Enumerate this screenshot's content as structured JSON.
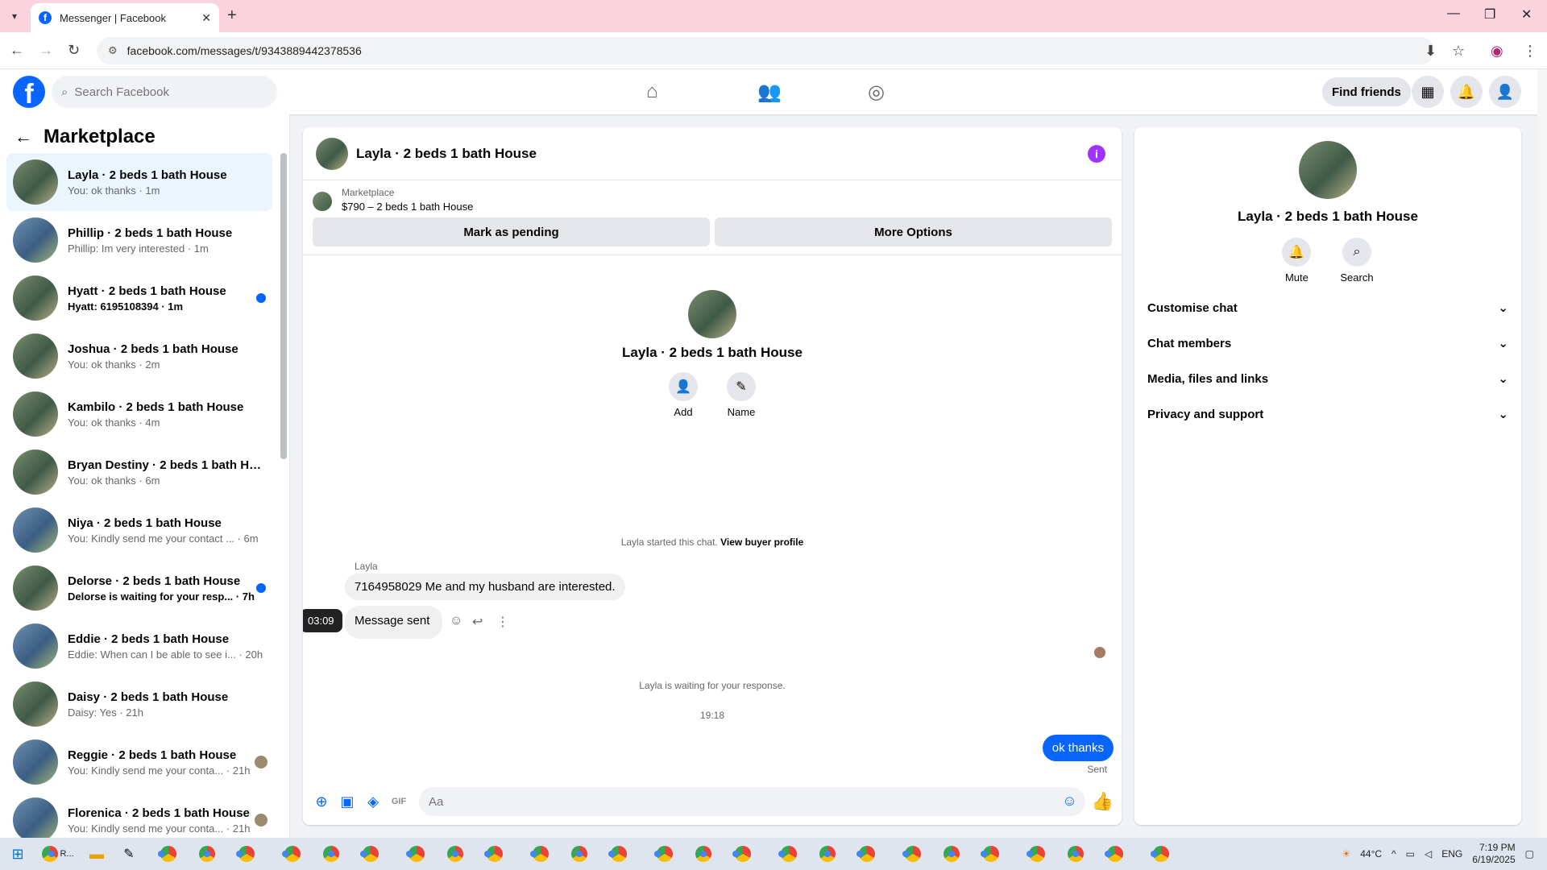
{
  "browser": {
    "tab_title": "Messenger | Facebook",
    "url": "facebook.com/messages/t/9343889442378536"
  },
  "header": {
    "search_placeholder": "Search Facebook",
    "find_friends": "Find friends"
  },
  "sidebar": {
    "title": "Marketplace",
    "conversations": [
      {
        "name": "Layla · 2 beds 1 bath House",
        "preview": "You: ok thanks · 1m",
        "active": true,
        "unread": false,
        "badge": ""
      },
      {
        "name": "Phillip · 2 beds 1 bath House",
        "preview": "Phillip: Im very interested · 1m",
        "active": false,
        "unread": false,
        "badge": ""
      },
      {
        "name": "Hyatt · 2 beds 1 bath House",
        "preview": "Hyatt: 6195108394 · 1m",
        "active": false,
        "unread": true,
        "badge": "dot"
      },
      {
        "name": "Joshua · 2 beds 1 bath House",
        "preview": "You: ok thanks · 2m",
        "active": false,
        "unread": false,
        "badge": ""
      },
      {
        "name": "Kambilo · 2 beds 1 bath House",
        "preview": "You: ok thanks · 4m",
        "active": false,
        "unread": false,
        "badge": ""
      },
      {
        "name": "Bryan Destiny · 2 beds 1 bath Ho...",
        "preview": "You: ok thanks · 6m",
        "active": false,
        "unread": false,
        "badge": ""
      },
      {
        "name": "Niya · 2 beds 1 bath House",
        "preview": "You: Kindly send me your contact ... · 6m",
        "active": false,
        "unread": false,
        "badge": ""
      },
      {
        "name": "Delorse · 2 beds 1 bath House",
        "preview": "Delorse is waiting for your resp... · 7h",
        "active": false,
        "unread": true,
        "badge": "dot"
      },
      {
        "name": "Eddie · 2 beds 1 bath House",
        "preview": "Eddie: When can I be able to see i... · 20h",
        "active": false,
        "unread": false,
        "badge": ""
      },
      {
        "name": "Daisy · 2 beds 1 bath House",
        "preview": "Daisy: Yes · 21h",
        "active": false,
        "unread": false,
        "badge": ""
      },
      {
        "name": "Reggie · 2 beds 1 bath House",
        "preview": "You: Kindly send me your conta... · 21h",
        "active": false,
        "unread": false,
        "badge": "avatar"
      },
      {
        "name": "Florenica · 2 beds 1 bath House",
        "preview": "You: Kindly send me your conta... · 21h",
        "active": false,
        "unread": false,
        "badge": "avatar"
      }
    ]
  },
  "chat": {
    "title": "Layla · 2 beds 1 bath House",
    "marketplace_label": "Marketplace",
    "listing": "$790 – 2 beds 1 bath House",
    "mark_pending": "Mark as pending",
    "more_options": "More Options",
    "intro_name": "Layla · 2 beds 1 bath House",
    "add_label": "Add",
    "name_label": "Name",
    "started_text": "Layla started this chat.",
    "view_profile": "View buyer profile",
    "sender": "Layla",
    "msg1": "7164958029 Me and my husband are interested.",
    "msg2": "Message sent",
    "tooltip": "03:09",
    "waiting": "Layla is waiting for your response.",
    "time": "19:18",
    "my_msg": "ok thanks",
    "status": "Sent",
    "compose_placeholder": "Aa"
  },
  "details": {
    "name": "Layla · 2 beds 1 bath House",
    "mute": "Mute",
    "search": "Search",
    "sections": [
      "Customise chat",
      "Chat members",
      "Media, files and links",
      "Privacy and support"
    ]
  },
  "taskbar": {
    "temperature": "44°C",
    "lang": "ENG",
    "time": "7:19 PM",
    "date": "6/19/2025",
    "first_app": "R..."
  }
}
